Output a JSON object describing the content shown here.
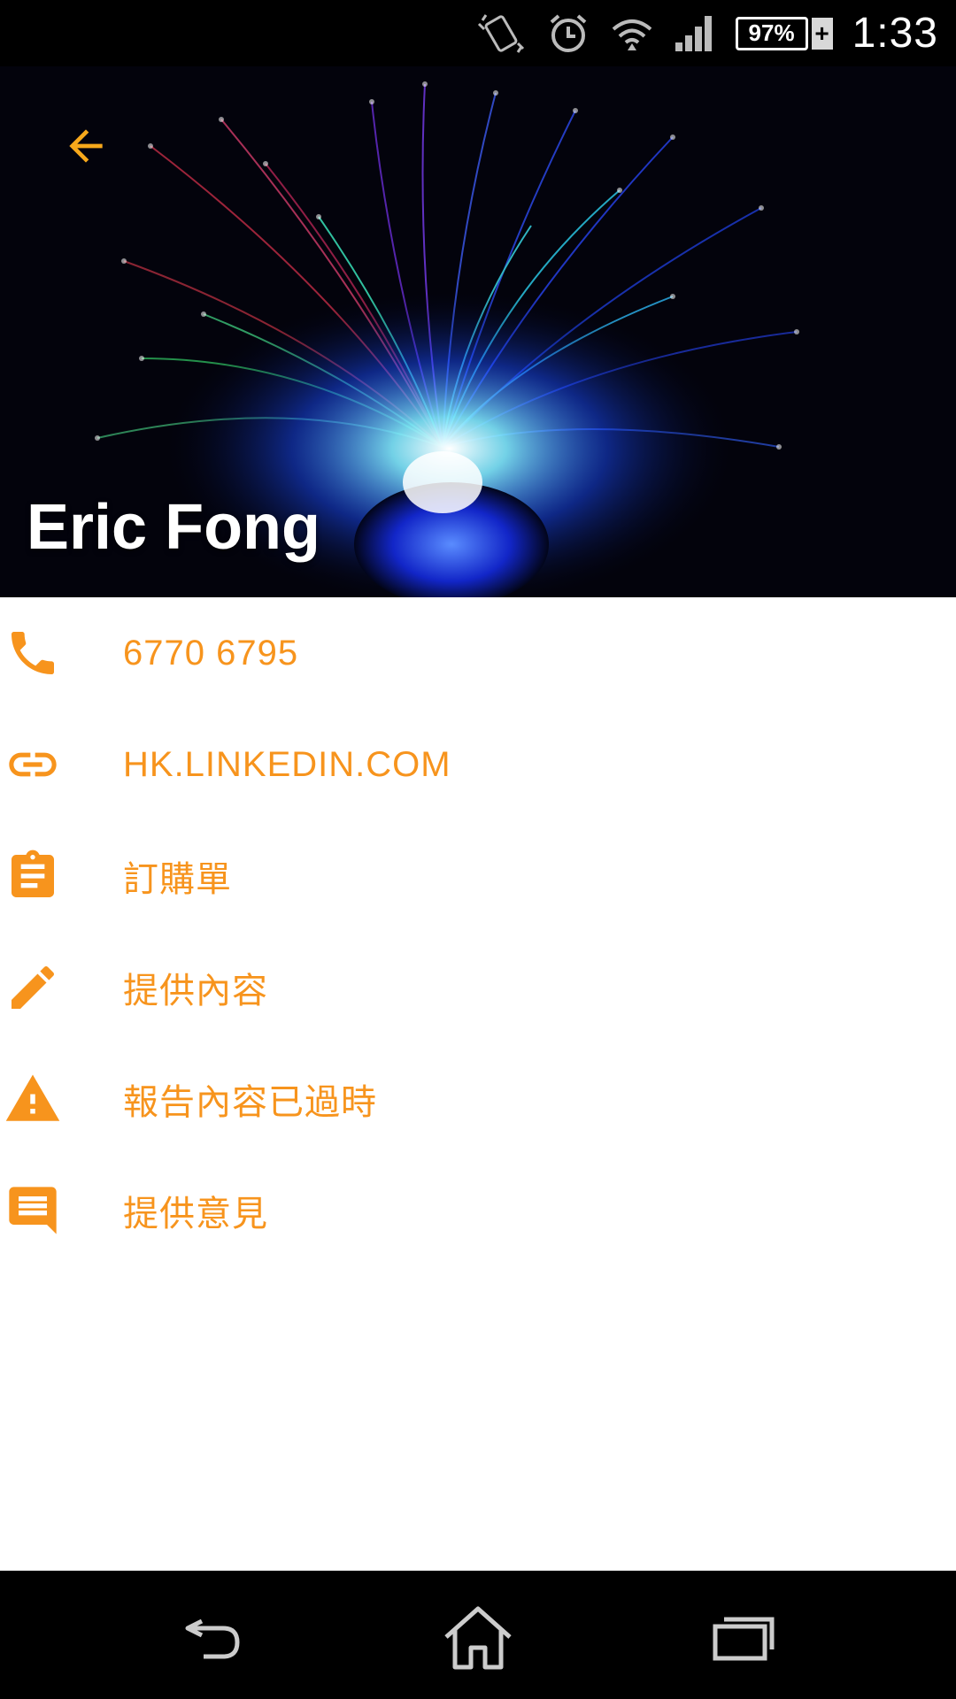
{
  "status_bar": {
    "battery_percent": "97%",
    "battery_charging_symbol": "+",
    "time": "1:33",
    "icons": [
      "vibrate-icon",
      "alarm-icon",
      "wifi-icon",
      "signal-icon",
      "battery-icon"
    ]
  },
  "header": {
    "name": "Eric Fong",
    "back_icon": "arrow-back-icon"
  },
  "items": [
    {
      "icon": "phone-icon",
      "label": "6770 6795"
    },
    {
      "icon": "link-icon",
      "label": "HK.LINKEDIN.COM"
    },
    {
      "icon": "clipboard-icon",
      "label": "訂購單"
    },
    {
      "icon": "pencil-icon",
      "label": "提供內容"
    },
    {
      "icon": "warning-icon",
      "label": "報告內容已過時"
    },
    {
      "icon": "message-icon",
      "label": "提供意見"
    }
  ],
  "nav_bar": {
    "icons": [
      "nav-back-icon",
      "nav-home-icon",
      "nav-recents-icon"
    ]
  },
  "colors": {
    "accent": "#f7941d",
    "status_bar_bg": "#000000",
    "nav_bar_bg": "#000000"
  }
}
